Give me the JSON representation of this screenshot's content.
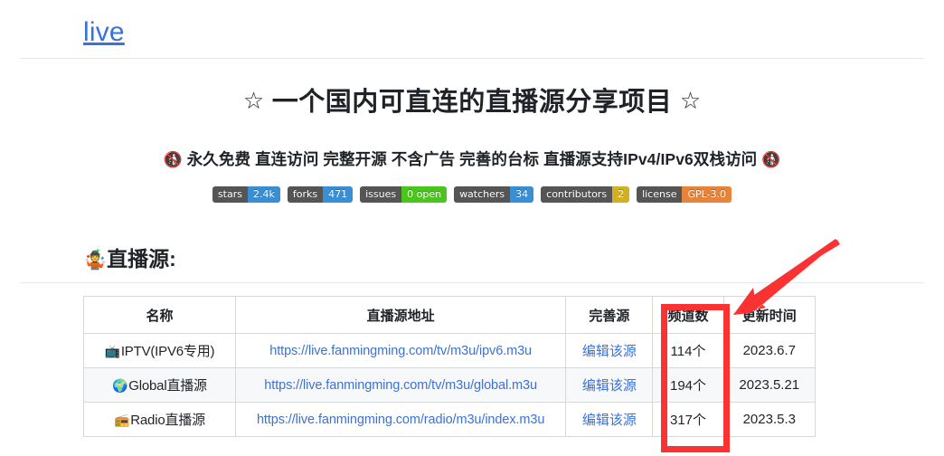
{
  "repo": {
    "title": "live"
  },
  "hero": {
    "heading_star_left": "☆",
    "heading_text": "一个国内可直连的直播源分享项目",
    "heading_star_right": "☆",
    "subtitle_emoji_left": "🚯",
    "subtitle_text": "永久免费 直连访问 完整开源 不含广告 完善的台标 直播源支持IPv4/IPv6双栈访问",
    "subtitle_emoji_right": "🚯"
  },
  "badges": [
    {
      "label": "stars",
      "value": "2.4k",
      "value_color": "#3a8fd4"
    },
    {
      "label": "forks",
      "value": "471",
      "value_color": "#3a8fd4"
    },
    {
      "label": "issues",
      "value": "0 open",
      "value_color": "#4ac51c"
    },
    {
      "label": "watchers",
      "value": "34",
      "value_color": "#3a8fd4"
    },
    {
      "label": "contributors",
      "value": "2",
      "value_color": "#d2b01e"
    },
    {
      "label": "license",
      "value": "GPL-3.0",
      "value_color": "#e8833a"
    }
  ],
  "section": {
    "emoji": "🤹",
    "title": "直播源:"
  },
  "table": {
    "headers": [
      "名称",
      "直播源地址",
      "完善源",
      "频道数",
      "更新时间"
    ],
    "rows": [
      {
        "emoji": "📺",
        "name": "IPTV(IPV6专用)",
        "url": "https://live.fanmingming.com/tv/m3u/ipv6.m3u",
        "edit": "编辑该源",
        "count": "114个",
        "updated": "2023.6.7"
      },
      {
        "emoji": "🌍",
        "name": "Global直播源",
        "url": "https://live.fanmingming.com/tv/m3u/global.m3u",
        "edit": "编辑该源",
        "count": "194个",
        "updated": "2023.5.21"
      },
      {
        "emoji": "📻",
        "name": "Radio直播源",
        "url": "https://live.fanmingming.com/radio/m3u/index.m3u",
        "edit": "编辑该源",
        "count": "317个",
        "updated": "2023.5.3"
      }
    ]
  },
  "annotations": {
    "highlight_color": "#fa3232",
    "highlight_target": "频道数",
    "arrow_color": "#fa3232"
  }
}
